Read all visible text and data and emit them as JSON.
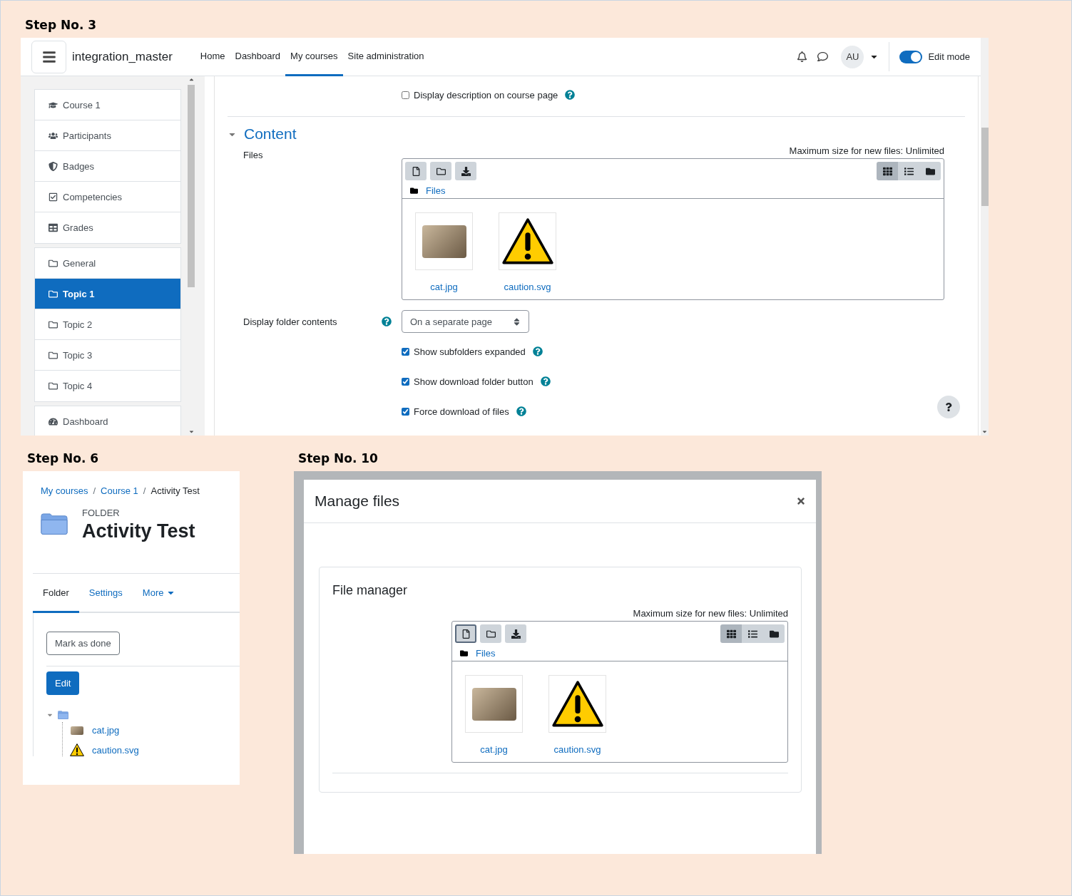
{
  "step3": {
    "heading": "Step No. 3",
    "navbar": {
      "site_name": "integration_master",
      "links": [
        {
          "label": "Home",
          "selected": false
        },
        {
          "label": "Dashboard",
          "selected": false
        },
        {
          "label": "My courses",
          "selected": true
        },
        {
          "label": "Site administration",
          "selected": false
        }
      ],
      "avatar": "AU",
      "edit_mode": {
        "label": "Edit mode",
        "on": true
      }
    },
    "course_index": [
      {
        "label": "Course 1",
        "kind": "course",
        "selected": false
      },
      {
        "label": "Participants",
        "kind": "participants",
        "selected": false
      },
      {
        "label": "Badges",
        "kind": "badges",
        "selected": false
      },
      {
        "label": "Competencies",
        "kind": "competencies",
        "selected": false
      },
      {
        "label": "Grades",
        "kind": "grades",
        "selected": false
      },
      {
        "label": "General",
        "kind": "section",
        "selected": false
      },
      {
        "label": "Topic 1",
        "kind": "section",
        "selected": true
      },
      {
        "label": "Topic 2",
        "kind": "section",
        "selected": false
      },
      {
        "label": "Topic 3",
        "kind": "section",
        "selected": false
      },
      {
        "label": "Topic 4",
        "kind": "section",
        "selected": false
      },
      {
        "label": "Dashboard",
        "kind": "dashboard",
        "selected": false
      }
    ],
    "display_description": {
      "label": "Display description on course page",
      "checked": false
    },
    "section": {
      "title": "Content",
      "expanded": true
    },
    "files_label": "Files",
    "file_manager": {
      "max_size": "Maximum size for new files: Unlimited",
      "path": "Files",
      "view_modes": [
        {
          "kind": "grid",
          "selected": true
        },
        {
          "kind": "list",
          "selected": false
        },
        {
          "kind": "tree",
          "selected": false
        }
      ],
      "files": [
        {
          "name": "cat.jpg",
          "kind": "image"
        },
        {
          "name": "caution.svg",
          "kind": "warning"
        }
      ]
    },
    "display_folder_contents": {
      "label": "Display folder contents",
      "value": "On a separate page"
    },
    "options": [
      {
        "label": "Show subfolders expanded",
        "checked": true
      },
      {
        "label": "Show download folder button",
        "checked": true
      },
      {
        "label": "Force download of files",
        "checked": true
      }
    ]
  },
  "step6": {
    "heading": "Step No. 6",
    "breadcrumbs": [
      {
        "label": "My courses",
        "link": true
      },
      {
        "separator": "/",
        "label": "Course 1",
        "link": true
      },
      {
        "separator": "/",
        "label": "Activity Test",
        "link": false
      }
    ],
    "activity_type": "FOLDER",
    "title": "Activity Test",
    "tabs": [
      {
        "label": "Folder",
        "selected": true,
        "kind": "tab"
      },
      {
        "label": "Settings",
        "selected": false,
        "kind": "tab"
      },
      {
        "label": "More",
        "selected": false,
        "kind": "menu"
      }
    ],
    "mark_done": "Mark as done",
    "edit_button": "Edit",
    "tree": {
      "expanded": true,
      "children": [
        {
          "name": "cat.jpg",
          "kind": "image"
        },
        {
          "name": "caution.svg",
          "kind": "warning"
        }
      ]
    }
  },
  "step10": {
    "heading": "Step No. 10",
    "modal_title": "Manage files",
    "card_title": "File manager",
    "file_manager": {
      "max_size": "Maximum size for new files: Unlimited",
      "path": "Files",
      "view_modes": [
        {
          "kind": "grid",
          "selected": true
        },
        {
          "kind": "list",
          "selected": false
        },
        {
          "kind": "tree",
          "selected": false
        }
      ],
      "files": [
        {
          "name": "cat.jpg",
          "kind": "image"
        },
        {
          "name": "caution.svg",
          "kind": "warning"
        }
      ]
    }
  }
}
